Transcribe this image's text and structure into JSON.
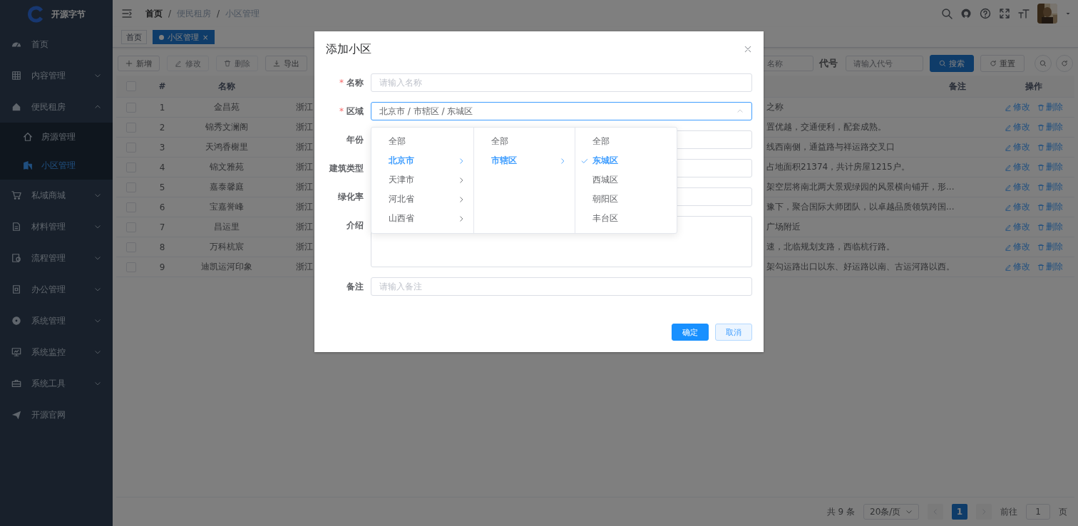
{
  "sidebar": {
    "logo_text": "开源字节",
    "items": [
      {
        "label": "首页",
        "kind": "link",
        "selected": false
      },
      {
        "label": "内容管理",
        "kind": "group",
        "expanded": false
      },
      {
        "label": "便民租房",
        "kind": "group",
        "expanded": true,
        "children": [
          {
            "label": "房源管理",
            "selected": false
          },
          {
            "label": "小区管理",
            "selected": true
          }
        ]
      },
      {
        "label": "私域商城",
        "kind": "group",
        "expanded": false
      },
      {
        "label": "材料管理",
        "kind": "group",
        "expanded": false
      },
      {
        "label": "流程管理",
        "kind": "group",
        "expanded": false
      },
      {
        "label": "办公管理",
        "kind": "group",
        "expanded": false
      },
      {
        "label": "系统管理",
        "kind": "group",
        "expanded": false
      },
      {
        "label": "系统监控",
        "kind": "group",
        "expanded": false
      },
      {
        "label": "系统工具",
        "kind": "group",
        "expanded": false
      },
      {
        "label": "开源官网",
        "kind": "link",
        "selected": false
      }
    ]
  },
  "header": {
    "breadcrumb": [
      "首页",
      "便民租房",
      "小区管理"
    ],
    "separator": "/"
  },
  "tags": [
    {
      "label": "首页",
      "selected": false,
      "closable": false
    },
    {
      "label": "小区管理",
      "selected": true,
      "closable": true,
      "close": "×"
    }
  ],
  "toolbar": {
    "buttons": [
      {
        "label": "新增",
        "kind": "add",
        "disabled": false
      },
      {
        "label": "修改",
        "kind": "edit",
        "disabled": true
      },
      {
        "label": "删除",
        "kind": "delete",
        "disabled": true
      },
      {
        "label": "导出",
        "kind": "export",
        "disabled": false
      }
    ]
  },
  "search": {
    "fields": [
      {
        "placeholder": "名称"
      },
      {
        "label": "代号",
        "placeholder": "请输入代号"
      }
    ],
    "buttons": [
      {
        "label": "搜索",
        "kind": "primary"
      },
      {
        "label": "重置",
        "kind": "default"
      }
    ]
  },
  "table": {
    "header": {
      "checked": false,
      "index": "#",
      "name": "名称",
      "remark": "备注",
      "actions": "操作"
    },
    "rows": [
      {
        "checked": false,
        "index": "1",
        "name": "金昌苑",
        "column_3": "浙江",
        "column_4": "之称",
        "actions": [
          "修改",
          "删除"
        ]
      },
      {
        "checked": false,
        "index": "2",
        "name": "锦秀文澜阁",
        "column_3": "浙江",
        "column_4": "置优越，交通便利，配套成熟。",
        "actions": [
          "修改",
          "删除"
        ]
      },
      {
        "checked": false,
        "index": "3",
        "name": "天鸿香榭里",
        "column_3": "浙江",
        "column_4": "线西南侧，通益路与祥运路交叉口",
        "actions": [
          "修改",
          "删除"
        ]
      },
      {
        "checked": false,
        "index": "4",
        "name": "锦文雅苑",
        "column_3": "浙江",
        "column_4": "占地面积21374，共计房屋1215户。",
        "actions": [
          "修改",
          "删除"
        ]
      },
      {
        "checked": false,
        "index": "5",
        "name": "嘉泰馨庭",
        "column_3": "浙江",
        "column_4": "架空层将南北两大景观绿园的风景横向铺开，形...",
        "actions": [
          "修改",
          "删除"
        ]
      },
      {
        "checked": false,
        "index": "6",
        "name": "宝嘉誉峰",
        "column_3": "浙江",
        "column_4": "豫下，聚合国际大师团队，以卓越品质领筑跨国...",
        "actions": [
          "修改",
          "删除"
        ]
      },
      {
        "checked": false,
        "index": "7",
        "name": "昌运里",
        "column_3": "浙江",
        "column_4": "广场附近",
        "actions": [
          "修改",
          "删除"
        ]
      },
      {
        "checked": false,
        "index": "8",
        "name": "万科杭宸",
        "column_3": "浙江",
        "column_4": "速，北临规划支路，西临杭行路。",
        "actions": [
          "修改",
          "删除"
        ]
      },
      {
        "checked": false,
        "index": "9",
        "name": "迪凯运河印象",
        "column_3": "浙江",
        "column_4": "架勾运路出口以东、好运路以南、古运河路以西。",
        "actions": [
          "修改",
          "删除"
        ]
      }
    ]
  },
  "pagination": {
    "total": "共 9 条",
    "page_size": "20条/页",
    "pages": [
      {
        "label": "1",
        "selected": true
      }
    ],
    "goto_label": "前往",
    "goto_value": "1",
    "goto_suffix": "页"
  },
  "dialog": {
    "title": "添加小区",
    "required_mark": "*",
    "fields": [
      {
        "label": "名称",
        "required": true,
        "kind": "input",
        "placeholder": "请输入名称"
      },
      {
        "label": "区域",
        "required": true,
        "kind": "cascader",
        "value": "北京市 / 市辖区 / 东城区",
        "expanded": true
      },
      {
        "label": "年份",
        "required": false,
        "kind": "input"
      },
      {
        "label": "建筑类型",
        "required": false,
        "kind": "input"
      },
      {
        "label": "绿化率",
        "required": false,
        "kind": "input"
      },
      {
        "label": "介绍",
        "required": false,
        "kind": "textarea"
      },
      {
        "label": "备注",
        "required": false,
        "kind": "input",
        "placeholder": "请输入备注"
      }
    ],
    "cascader_panel": [
      [
        {
          "label": "全部",
          "selected": false,
          "has_children": false
        },
        {
          "label": "北京市",
          "selected": true,
          "has_children": true
        },
        {
          "label": "天津市",
          "selected": false,
          "has_children": true
        },
        {
          "label": "河北省",
          "selected": false,
          "has_children": true
        },
        {
          "label": "山西省",
          "selected": false,
          "has_children": true
        }
      ],
      [
        {
          "label": "全部",
          "selected": false,
          "has_children": false
        },
        {
          "label": "市辖区",
          "selected": true,
          "has_children": true
        }
      ],
      [
        {
          "label": "全部",
          "selected": false,
          "has_children": false
        },
        {
          "label": "东城区",
          "selected": true,
          "has_children": false
        },
        {
          "label": "西城区",
          "selected": false,
          "has_children": false
        },
        {
          "label": "朝阳区",
          "selected": false,
          "has_children": false
        },
        {
          "label": "丰台区",
          "selected": false,
          "has_children": false
        }
      ]
    ],
    "buttons": [
      {
        "label": "确定",
        "kind": "primary"
      },
      {
        "label": "取消",
        "kind": "default"
      }
    ]
  }
}
